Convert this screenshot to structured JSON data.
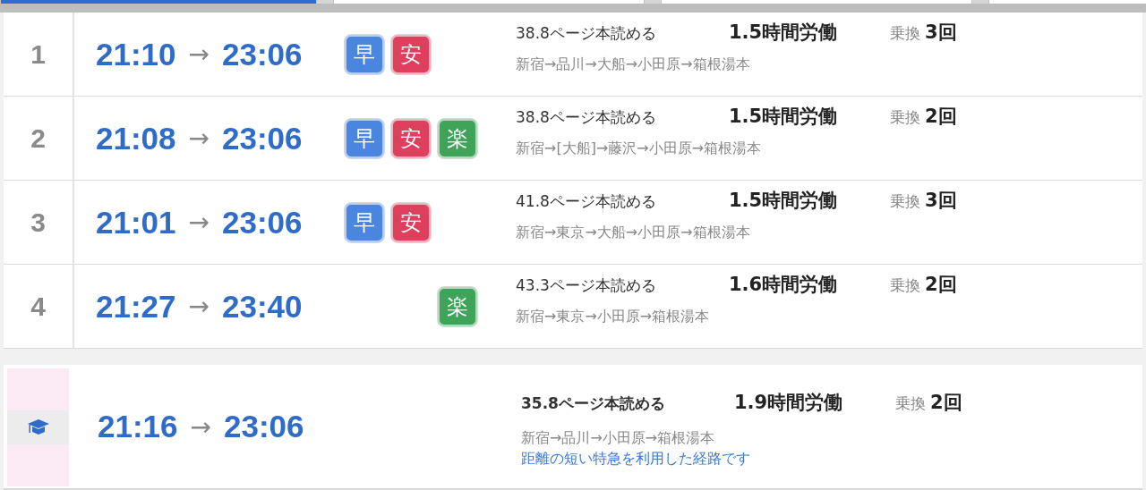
{
  "tabs": [
    {
      "selected": true
    },
    {
      "selected": false
    },
    {
      "selected": false
    },
    {
      "selected": false
    }
  ],
  "routes": [
    {
      "index": "1",
      "depart": "21:10",
      "arrow": "→",
      "arrive": "23:06",
      "badges": [
        {
          "kind": "fast",
          "label": "早",
          "color": "#4a86e0"
        },
        {
          "kind": "cheap",
          "label": "安",
          "color": "#dd3f5c"
        }
      ],
      "pages": "38.8ページ本読める",
      "work": "1.5時間労働",
      "transfer_label": "乗換",
      "transfers": "3回",
      "path": "新宿→品川→大船→小田原→箱根湯本"
    },
    {
      "index": "2",
      "depart": "21:08",
      "arrow": "→",
      "arrive": "23:06",
      "badges": [
        {
          "kind": "fast",
          "label": "早",
          "color": "#4a86e0"
        },
        {
          "kind": "cheap",
          "label": "安",
          "color": "#dd3f5c"
        },
        {
          "kind": "easy",
          "label": "楽",
          "color": "#3fa45a"
        }
      ],
      "pages": "38.8ページ本読める",
      "work": "1.5時間労働",
      "transfer_label": "乗換",
      "transfers": "2回",
      "path": "新宿→[大船]→藤沢→小田原→箱根湯本"
    },
    {
      "index": "3",
      "depart": "21:01",
      "arrow": "→",
      "arrive": "23:06",
      "badges": [
        {
          "kind": "fast",
          "label": "早",
          "color": "#4a86e0"
        },
        {
          "kind": "cheap",
          "label": "安",
          "color": "#dd3f5c"
        }
      ],
      "pages": "41.8ページ本読める",
      "work": "1.5時間労働",
      "transfer_label": "乗換",
      "transfers": "3回",
      "path": "新宿→東京→大船→小田原→箱根湯本"
    },
    {
      "index": "4",
      "depart": "21:27",
      "arrow": "→",
      "arrive": "23:40",
      "badges": [
        {
          "kind": "easy",
          "label": "楽",
          "color": "#3fa45a"
        }
      ],
      "pages": "43.3ページ本読める",
      "work": "1.6時間労働",
      "transfer_label": "乗換",
      "transfers": "2回",
      "path": "新宿→東京→小田原→箱根湯本"
    }
  ],
  "recommended": {
    "depart": "21:16",
    "arrow": "→",
    "arrive": "23:06",
    "pages": "35.8ページ本読める",
    "work": "1.9時間労働",
    "transfer_label": "乗換",
    "transfers": "2回",
    "path": "新宿→品川→小田原→箱根湯本",
    "note": "距離の短い特急を利用した経路です"
  }
}
